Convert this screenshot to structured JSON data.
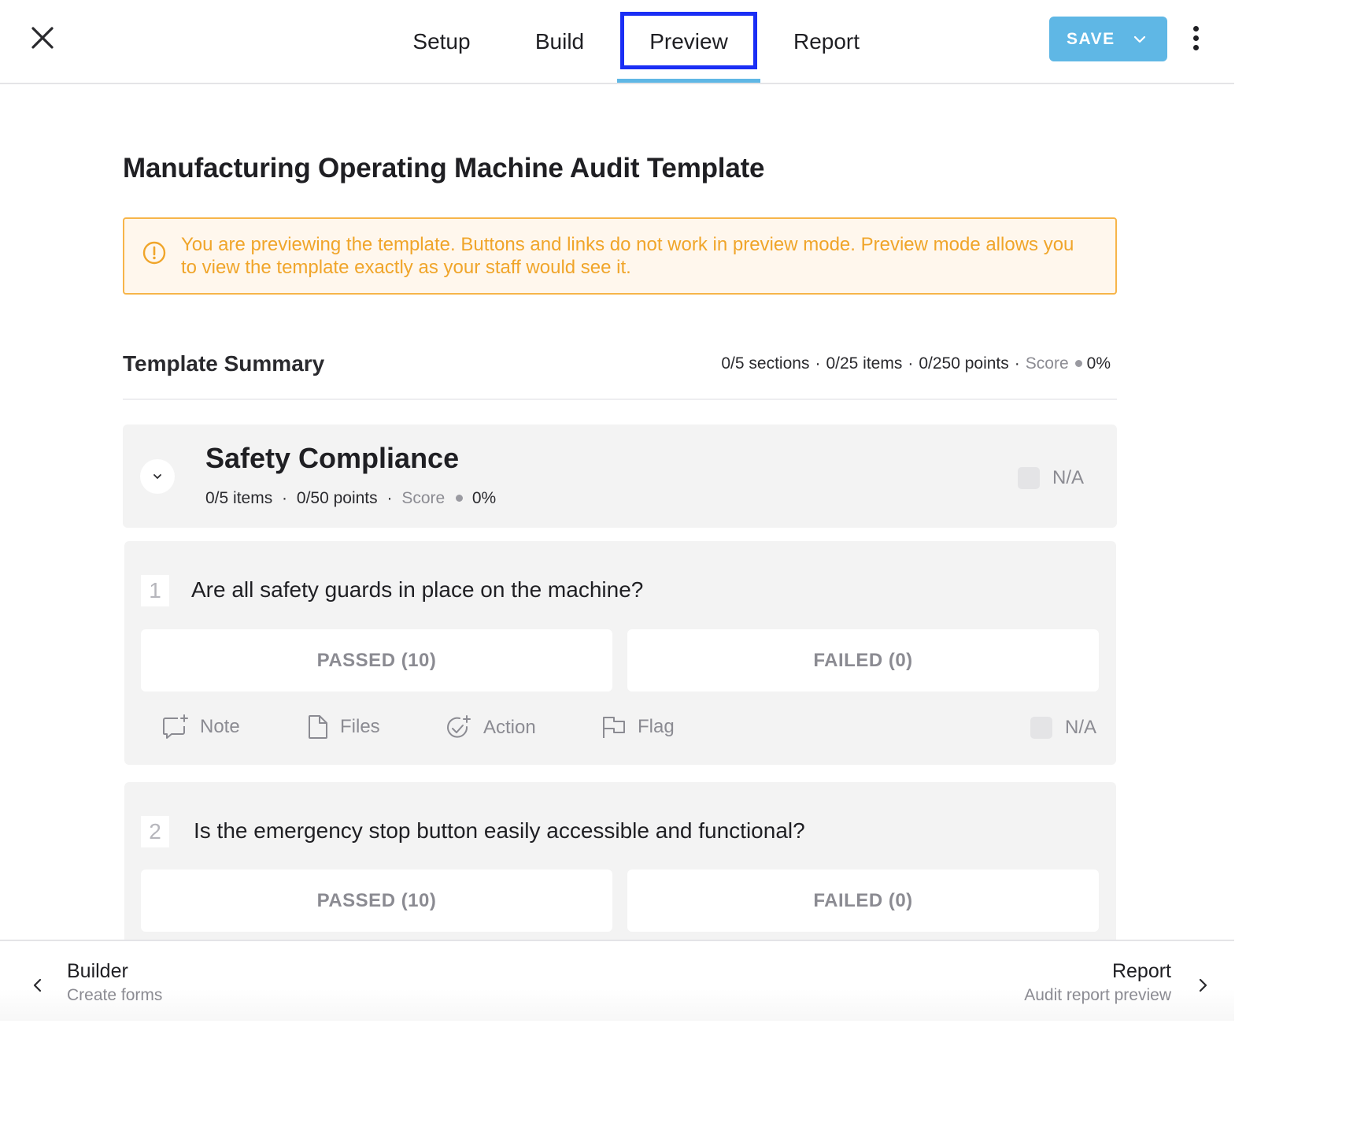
{
  "header": {
    "tabs": [
      {
        "label": "Setup"
      },
      {
        "label": "Build"
      },
      {
        "label": "Preview",
        "active": true
      },
      {
        "label": "Report"
      }
    ],
    "save_label": "SAVE"
  },
  "page": {
    "title": "Manufacturing Operating Machine Audit Template",
    "alert": "You are previewing the template. Buttons and links do not work in preview mode. Preview mode allows you to view the template exactly as your staff would see it."
  },
  "summary": {
    "title": "Template Summary",
    "sections": "0/5 sections",
    "items": "0/25 items",
    "points": "0/250 points",
    "score_label": "Score",
    "score_value": "0%",
    "sep": "·"
  },
  "section": {
    "title": "Safety Compliance",
    "items": "0/5 items",
    "points": "0/50 points",
    "score_label": "Score",
    "score_value": "0%",
    "na_label": "N/A"
  },
  "questions": [
    {
      "number": "1",
      "text": "Are all safety guards in place on the machine?",
      "passed_label": "PASSED (10)",
      "failed_label": "FAILED (0)",
      "actions": {
        "note": "Note",
        "files": "Files",
        "action": "Action",
        "flag": "Flag"
      },
      "na_label": "N/A"
    },
    {
      "number": "2",
      "text": "Is the emergency stop button easily accessible and functional?",
      "passed_label": "PASSED (10)",
      "failed_label": "FAILED (0)"
    }
  ],
  "footer": {
    "prev": {
      "title": "Builder",
      "subtitle": "Create forms"
    },
    "next": {
      "title": "Report",
      "subtitle": "Audit report preview"
    }
  },
  "colors": {
    "accent": "#5fb7e5",
    "focus_outline": "#1a2ef5",
    "warning_text": "#f0a52a",
    "warning_border": "#f7b54a",
    "card_bg": "#f3f3f3"
  }
}
